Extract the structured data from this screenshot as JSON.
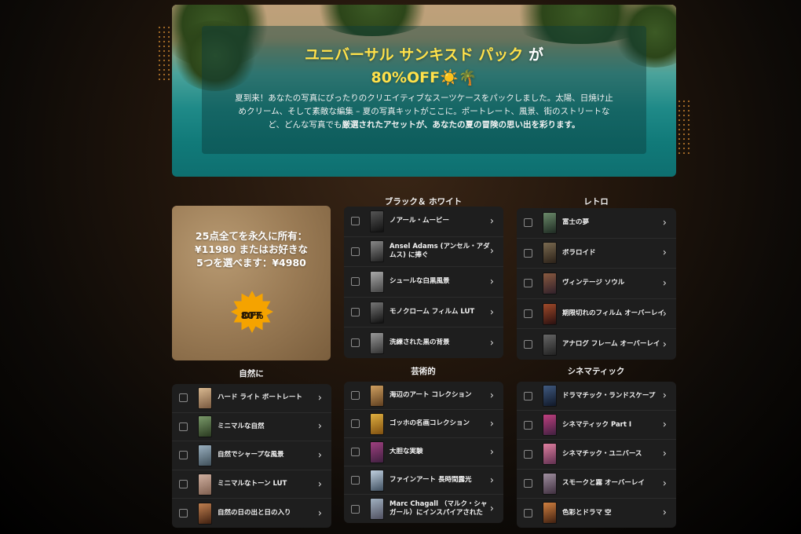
{
  "hero": {
    "title_line1": "ユニバーサル サンキスド パック",
    "title_line1_suffix": "が",
    "title_line2": "80%OFF☀️🌴",
    "desc_line1": "夏到来！あなたの写真にぴったりのクリエイティブなスーツケースをパックしました。太陽、日焼け止",
    "desc_line2": "めクリーム、そして素敵な編集 – 夏の写真キットがここに。ポートレート、風景、街のストリートな",
    "desc_line3_a": "ど、どんな写真でも",
    "desc_line3_b": "厳選されたアセットが、あなたの夏の冒険の思い出を彩ります。"
  },
  "promo": {
    "text": "25点全てを永久に所有：¥11980 またはお好きな5つを選べます：¥4980",
    "badge_line1": "80%",
    "badge_line2": "OFF"
  },
  "categories": {
    "bw": {
      "title": "ブラック＆ ホワイト",
      "items": [
        "ノアール・ムービー",
        "Ansel Adams (アンセル・アダムス) に捧ぐ",
        "シュールな白黒風景",
        "モノクローム フィルム LUT",
        "洗練された黒の背景"
      ]
    },
    "retro": {
      "title": "レトロ",
      "items": [
        "富士の夢",
        "ポラロイド",
        "ヴィンテージ ソウル",
        "期限切れのフィルム オーバーレイ",
        "アナログ フレーム オーバーレイ"
      ]
    },
    "nature": {
      "title": "自然に",
      "items": [
        "ハード ライト ポートレート",
        "ミニマルな自然",
        "自然でシャープな風景",
        "ミニマルなトーン LUT",
        "自然の日の出と日の入り"
      ]
    },
    "art": {
      "title": "芸術的",
      "items": [
        "海辺のアート コレクション",
        "ゴッホの名画コレクション",
        "大胆な実験",
        "ファインアート 長時間露光",
        "Marc Chagall （マルク・シャガール）にインスパイアされた"
      ]
    },
    "cine": {
      "title": "シネマティック",
      "items": [
        "ドラマチック・ランドスケープ",
        "シネマティック Part I",
        "シネマチック・ユニバース",
        "スモークと霧 オーバーレイ",
        "色彩とドラマ 空"
      ]
    }
  },
  "colors": {
    "accent_yellow": "#ffe14a",
    "panel_bg": "#1e1e1e",
    "badge_orange": "#f5a300"
  },
  "icons": {
    "row_arrow": "chevron-right-icon",
    "badge": "starburst-badge-icon"
  }
}
